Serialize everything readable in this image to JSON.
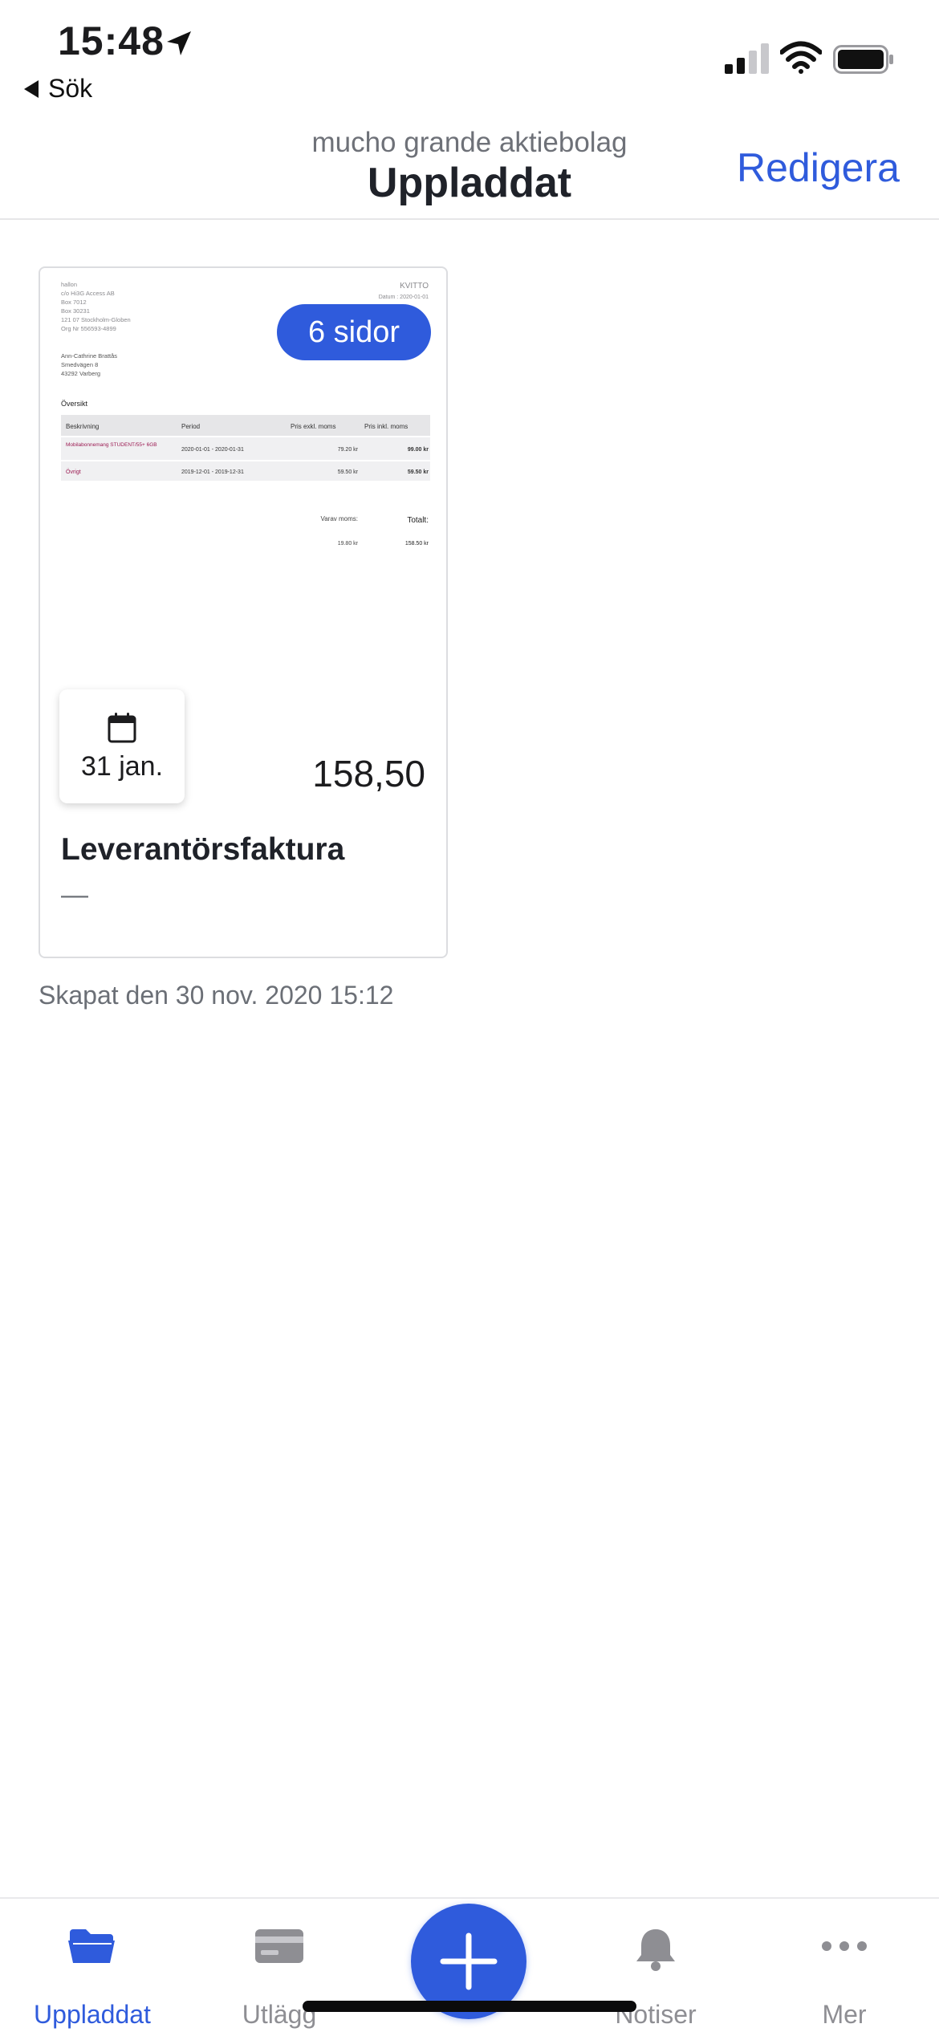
{
  "status_bar": {
    "time": "15:48",
    "back_label": "Sök"
  },
  "nav": {
    "subtitle": "mucho grande aktiebolag",
    "title": "Uppladdat",
    "edit_label": "Redigera"
  },
  "card": {
    "pages_badge": "6 sidor",
    "date": "31 jan.",
    "amount": "158,50",
    "doc_type": "Leverantörsfaktura",
    "description": "—",
    "preview": {
      "sender_lines": [
        "hallon",
        "c/o Hi3G Access AB",
        "Box 7012",
        "Box 30231",
        "121 07 Stockholm-Globen",
        "Org Nr 556593-4899"
      ],
      "recipient_lines": [
        "Ann-Cathrine Brattås",
        "Smedvägen 8",
        "43292 Varberg"
      ],
      "doc_label": "KVITTO",
      "date_line": "Datum : 2020-01-01",
      "overview_label": "Översikt",
      "headers": [
        "Beskrivning",
        "Period",
        "Pris exkl. moms",
        "Pris inkl. moms"
      ],
      "rows": [
        [
          "Mobilabonnemang STUDENT/55+ 6GB",
          "2020-01-01 - 2020-01-31",
          "79.20 kr",
          "99.00 kr"
        ],
        [
          "Övrigt",
          "2019-12-01 - 2019-12-31",
          "59.50 kr",
          "59.50 kr"
        ]
      ],
      "vat_label": "Varav moms:",
      "total_label": "Totalt:",
      "vat_value": "19.80 kr",
      "total_value": "158.50 kr"
    }
  },
  "created_text": "Skapat den 30 nov. 2020 15:12",
  "tabs": [
    {
      "label": "Uppladdat",
      "icon": "folder-icon",
      "active": true
    },
    {
      "label": "Utlägg",
      "icon": "card-icon",
      "active": false
    },
    {
      "label": "Notiser",
      "icon": "bell-icon",
      "active": false
    },
    {
      "label": "Mer",
      "icon": "more-icon",
      "active": false
    }
  ],
  "colors": {
    "accent": "#2f5bdc",
    "text": "#1c1c1e",
    "muted": "#6e7178",
    "preview_accent": "#9b1a52"
  }
}
